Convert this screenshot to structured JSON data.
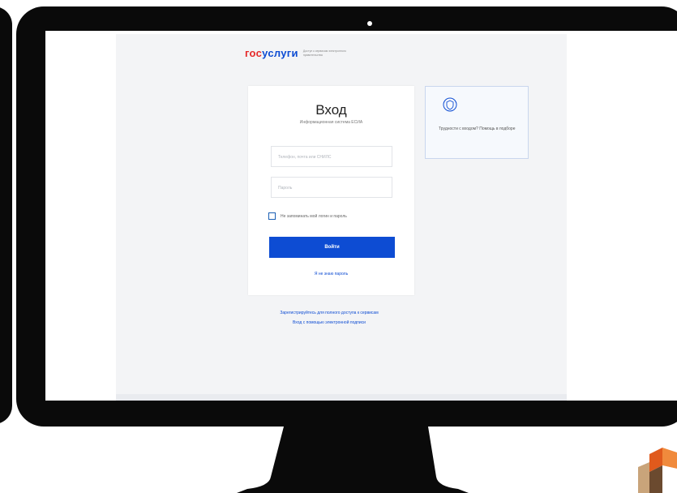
{
  "logo": {
    "part1": "гос",
    "part2": "услуги",
    "tagline": "Доступ к сервисам электронного правительства"
  },
  "login": {
    "title": "Вход",
    "subtitle": "Информационная система ЕСИА",
    "login_placeholder": "Телефон, почта или СНИЛС",
    "password_placeholder": "Пароль",
    "remember_label": "Не запоминать мой логин и пароль",
    "submit_label": "Войти",
    "forgot_link": "Я не знаю пароль"
  },
  "side_card": {
    "text": "Трудности с входом? Помощь в подборе"
  },
  "footer": {
    "line1": "Зарегистрируйтесь для полного доступа к сервисам",
    "line2": "Вход с помощью электронной подписи"
  },
  "colors": {
    "brand_blue": "#0d4cd3",
    "brand_red": "#e52a2a",
    "monitor_frame": "#0a0a0a"
  }
}
